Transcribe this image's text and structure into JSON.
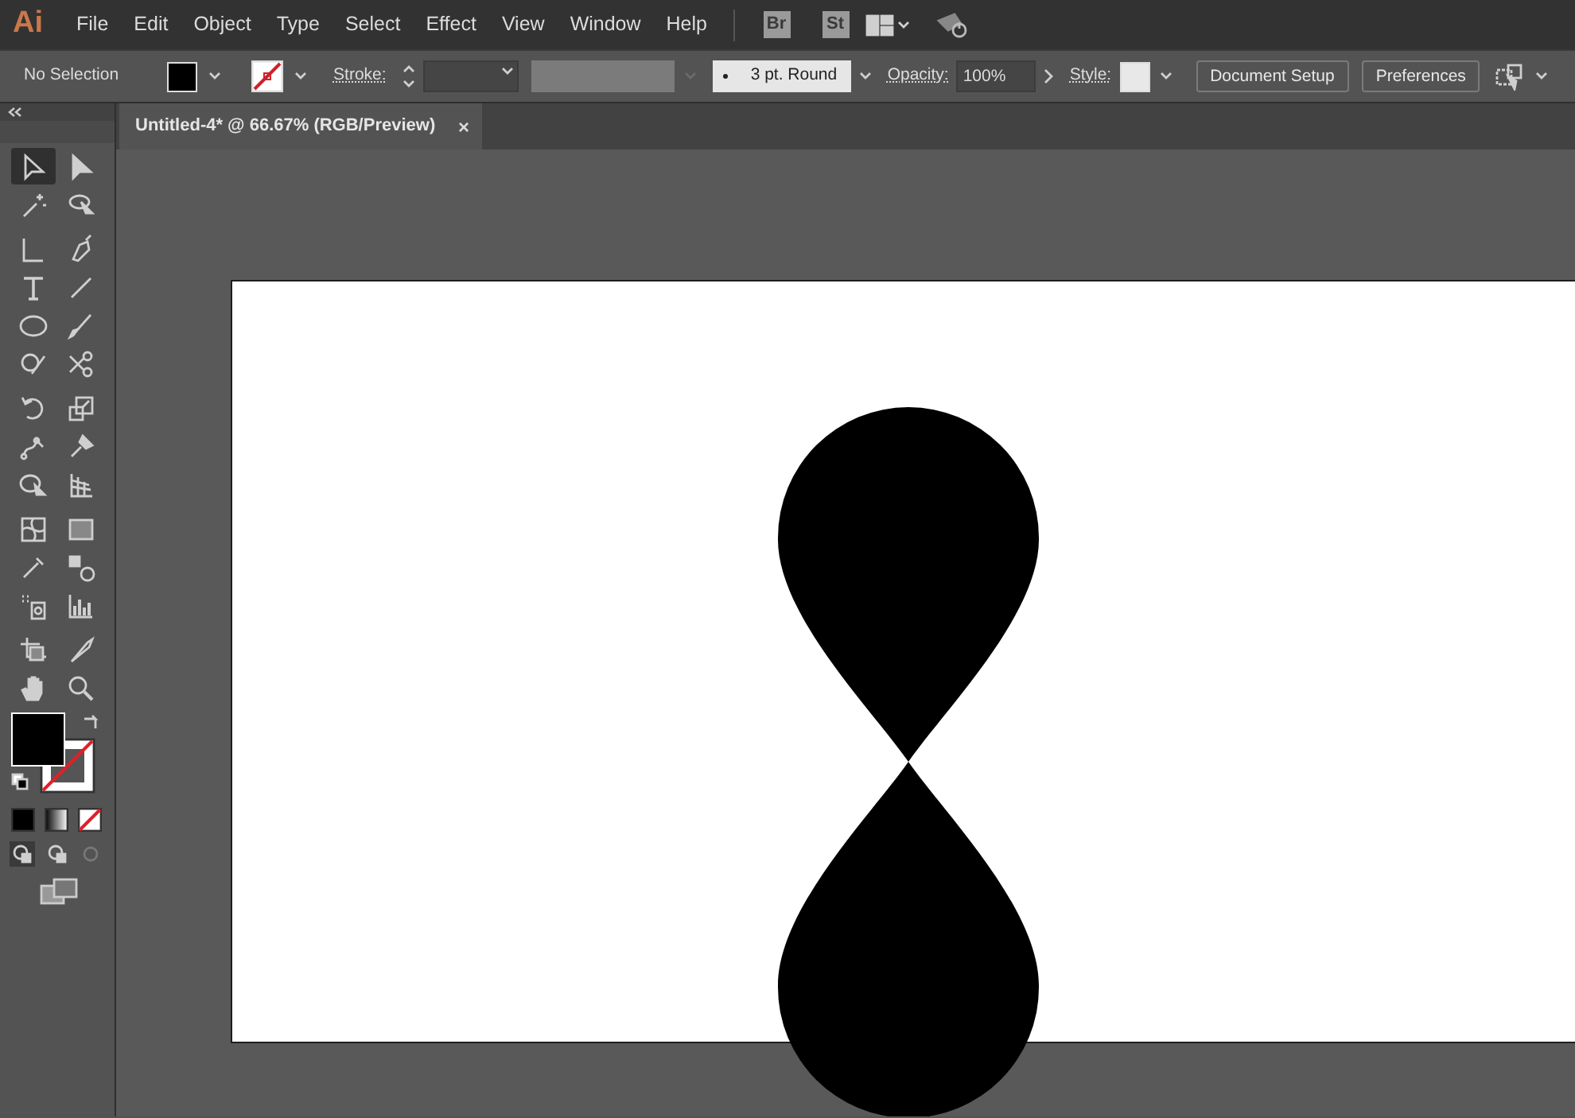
{
  "app": {
    "logo": "Ai"
  },
  "menu": [
    "File",
    "Edit",
    "Object",
    "Type",
    "Select",
    "Effect",
    "View",
    "Window",
    "Help"
  ],
  "bridge_buttons": [
    "Br",
    "St"
  ],
  "control_bar": {
    "selection": "No Selection",
    "stroke_label": "Stroke:",
    "brush": "3 pt. Round",
    "opacity_label": "Opacity:",
    "opacity": "100%",
    "style_label": "Style:",
    "buttons": [
      "Document Setup",
      "Preferences"
    ]
  },
  "document_tab": {
    "title": "Untitled-4* @ 66.67% (RGB/Preview)",
    "close": "×"
  },
  "tools": [
    {
      "kind": "selection",
      "selected": true
    },
    {
      "kind": "direct-selection",
      "selected": false
    },
    {
      "kind": "magic-wand",
      "selected": false
    },
    {
      "kind": "lasso",
      "selected": false
    },
    {
      "kind": "curvature",
      "selected": false
    },
    {
      "kind": "pen",
      "selected": false
    },
    {
      "kind": "type",
      "selected": false
    },
    {
      "kind": "line",
      "selected": false
    },
    {
      "kind": "ellipse",
      "selected": false
    },
    {
      "kind": "paintbrush",
      "selected": false
    },
    {
      "kind": "shaper",
      "selected": false
    },
    {
      "kind": "scissors",
      "selected": false
    },
    {
      "kind": "rotate",
      "selected": false
    },
    {
      "kind": "scale",
      "selected": false
    },
    {
      "kind": "puppet",
      "selected": false
    },
    {
      "kind": "pin",
      "selected": false
    },
    {
      "kind": "shape-builder",
      "selected": false
    },
    {
      "kind": "perspective",
      "selected": false
    },
    {
      "kind": "mesh",
      "selected": false
    },
    {
      "kind": "gradient",
      "selected": false
    },
    {
      "kind": "eyedropper",
      "selected": false
    },
    {
      "kind": "blend",
      "selected": false
    },
    {
      "kind": "sprayer",
      "selected": false
    },
    {
      "kind": "graph",
      "selected": false
    },
    {
      "kind": "artboard",
      "selected": false
    },
    {
      "kind": "knife",
      "selected": false
    },
    {
      "kind": "hand",
      "selected": false
    },
    {
      "kind": "zoom",
      "selected": false
    }
  ]
}
